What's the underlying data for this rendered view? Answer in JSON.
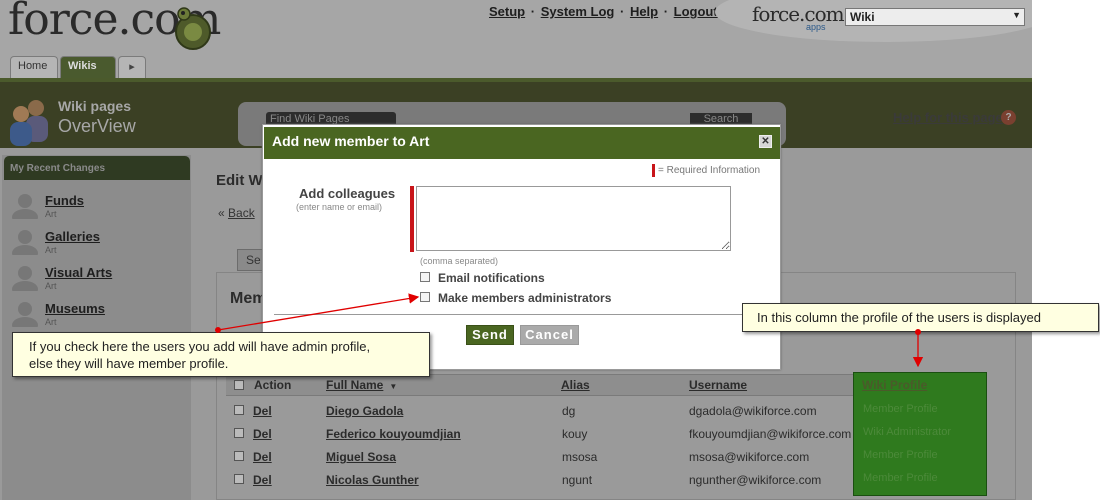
{
  "header": {
    "logo": "force.com",
    "links": [
      "Setup",
      "System Log",
      "Help",
      "Logout"
    ],
    "apps_logo": "force.com",
    "apps_sub": "apps",
    "app_selector": "Wiki",
    "tabs": [
      "Home",
      "Wikis",
      "▸"
    ]
  },
  "band": {
    "title1": "Wiki pages",
    "title2": "OverView",
    "search_placeholder": "Find Wiki Pages",
    "search_button": "Search",
    "help_link": "Help for this page"
  },
  "sidebar": {
    "heading": "My Recent Changes",
    "items": [
      {
        "title": "Funds",
        "sub": "Art"
      },
      {
        "title": "Galleries",
        "sub": "Art"
      },
      {
        "title": "Visual Arts",
        "sub": "Art"
      },
      {
        "title": "Museums",
        "sub": "Art"
      }
    ]
  },
  "main": {
    "edit_title": "Edit W",
    "back_link": "Back",
    "tab": "Se",
    "panel_title": "Mem",
    "columns": [
      "Action",
      "Full Name",
      "Alias",
      "Username",
      "Wiki Profile"
    ],
    "rows": [
      {
        "action": "Del",
        "name": "Diego Gadola",
        "alias": "dg",
        "username": "dgadola@wikiforce.com",
        "profile": "Member Profile"
      },
      {
        "action": "Del",
        "name": "Federico kouyoumdjian",
        "alias": "kouy",
        "username": "fkouyoumdjian@wikiforce.com",
        "profile": "Wiki Administrator"
      },
      {
        "action": "Del",
        "name": "Miguel Sosa",
        "alias": "msosa",
        "username": "msosa@wikiforce.com",
        "profile": "Member Profile"
      },
      {
        "action": "Del",
        "name": "Nicolas Gunther",
        "alias": "ngunt",
        "username": "ngunther@wikiforce.com",
        "profile": "Member Profile"
      }
    ]
  },
  "modal": {
    "title": "Add new member to Art",
    "required_text": "= Required Information",
    "colleagues_label": "Add colleagues",
    "colleagues_hint": "(enter name or email)",
    "colleagues_value": "",
    "comma_note": "(comma separated)",
    "email_notifications": "Email notifications",
    "make_admins": "Make members administrators",
    "send": "Send",
    "cancel": "Cancel"
  },
  "callouts": {
    "left_line1": "If you check here the users you add will have admin profile,",
    "left_line2": "else they will have member profile.",
    "right": "In this column the profile of the users is displayed"
  },
  "colors": {
    "accent_green": "#4a6621",
    "required_red": "#c8151a",
    "arrow_red": "#e00000",
    "callout_bg": "#ffffe1",
    "highlight_green": "#2f7a1e"
  }
}
